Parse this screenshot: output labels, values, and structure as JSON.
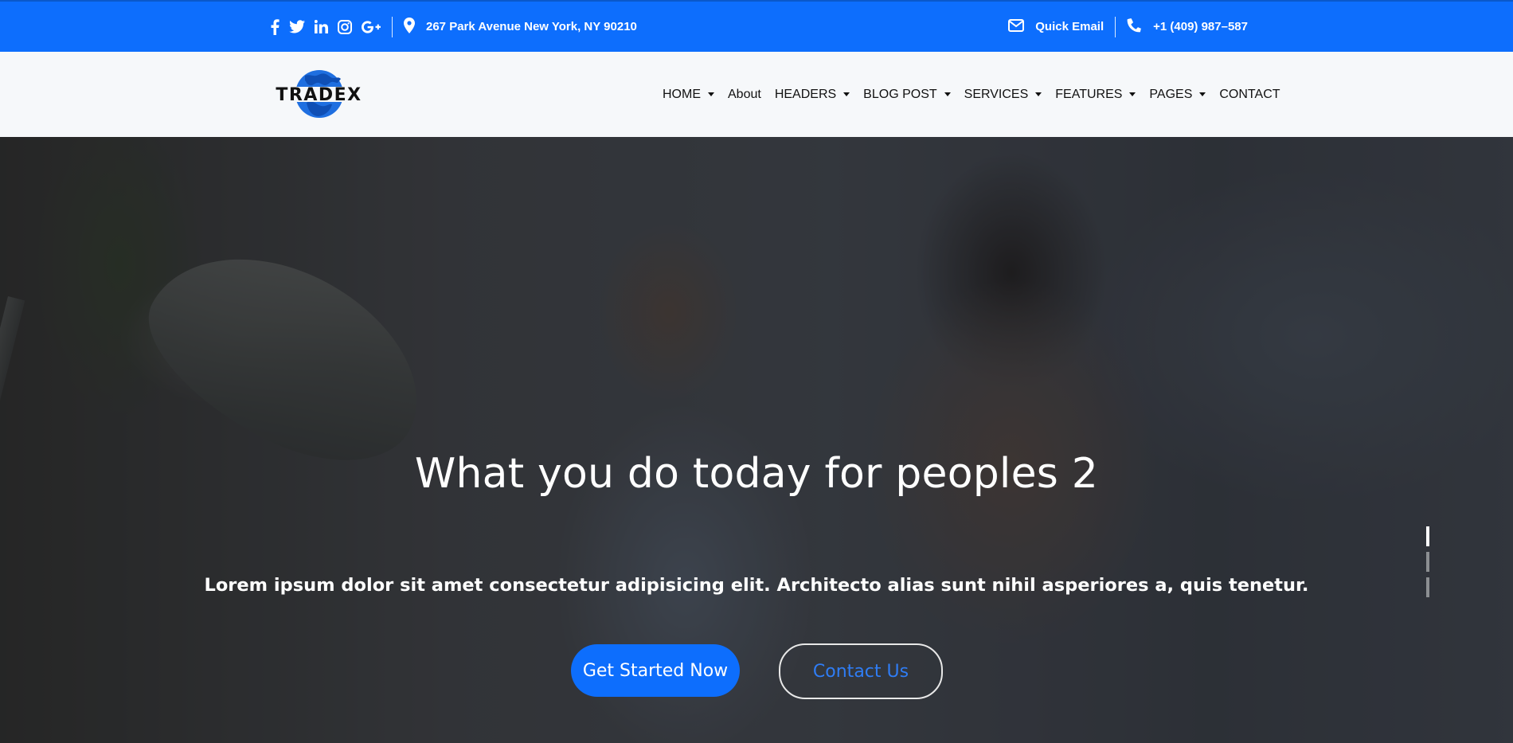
{
  "topbar": {
    "social_icons": [
      "facebook-icon",
      "twitter-icon",
      "linkedin-icon",
      "instagram-icon",
      "google-plus-icon"
    ],
    "address": "267 Park Avenue New York, NY 90210",
    "email_label": "Quick Email",
    "phone": "+1 (409) 987–587",
    "bg_color": "#0d6efd"
  },
  "header": {
    "logo_text": "TRADEX",
    "nav": [
      {
        "label": "HOME",
        "dropdown": true
      },
      {
        "label": "About",
        "dropdown": false
      },
      {
        "label": "HEADERS",
        "dropdown": true
      },
      {
        "label": "BLOG POST",
        "dropdown": true
      },
      {
        "label": "SERVICES",
        "dropdown": true
      },
      {
        "label": "FEATURES",
        "dropdown": true
      },
      {
        "label": "PAGES",
        "dropdown": true
      },
      {
        "label": "CONTACT",
        "dropdown": false
      }
    ]
  },
  "hero": {
    "title": "What you do today for peoples 2",
    "subtitle": "Lorem ipsum dolor sit amet consectetur adipisicing elit. Architecto alias sunt nihil asperiores a, quis tenetur.",
    "primary_button": "Get Started Now",
    "secondary_button": "Contact Us",
    "slides": 3,
    "active_slide": 1,
    "accent_color": "#0d6efd"
  }
}
